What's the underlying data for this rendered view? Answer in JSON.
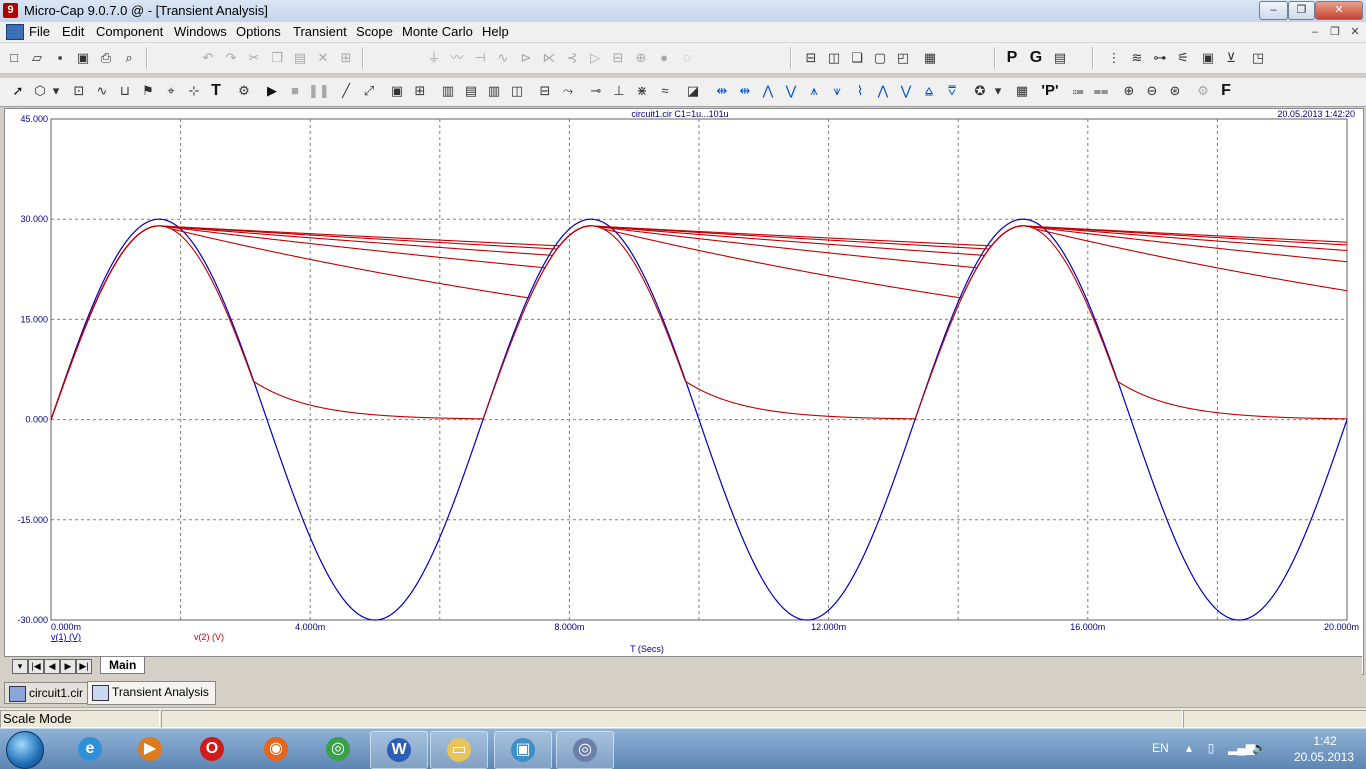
{
  "window": {
    "title": "Micro-Cap 9.0.7.0 @ - [Transient Analysis]",
    "app_icon_letter": "9",
    "controls": {
      "minimize": "–",
      "maximize": "❐",
      "close": "✕"
    },
    "mdi_controls": {
      "minimize": "–",
      "restore": "❐",
      "close": "✕"
    }
  },
  "menu": [
    "File",
    "Edit",
    "Component",
    "Windows",
    "Options",
    "Transient",
    "Scope",
    "Monte Carlo",
    "Help"
  ],
  "toolbar1": {
    "letter_buttons": [
      "P",
      "G"
    ]
  },
  "toolbar2": {
    "letter_buttons": [
      "'P'",
      "F"
    ],
    "text_tool": "T"
  },
  "plot": {
    "header_center": "circuit1.cir C1=1u...101u",
    "header_right": "20.05.2013 1:42:20",
    "xlabel": "T (Secs)",
    "legend": [
      {
        "label": "v(1) (V)",
        "color": "#0000c0"
      },
      {
        "label": "v(2) (V)",
        "color": "#c00000"
      }
    ],
    "colors": {
      "grid": "#808080",
      "axis_text": "#000080"
    }
  },
  "chart_data": {
    "type": "line",
    "x_unit_label": "T (Secs)",
    "xlim": [
      0,
      0.02
    ],
    "ylim": [
      -30,
      45
    ],
    "x_ticks": [
      "0.000m",
      "4.000m",
      "8.000m",
      "12.000m",
      "16.000m",
      "20.000m"
    ],
    "y_ticks": [
      "45.000",
      "30.000",
      "15.000",
      "0.000",
      "-15.000",
      "-30.000"
    ],
    "grid": true,
    "series": [
      {
        "name": "v(1) (V)",
        "color": "#0000c0",
        "waveform": "sine",
        "amplitude": 30,
        "frequency_hz": 150,
        "x": [
          0,
          0.00167,
          0.00333,
          0.005,
          0.00667,
          0.00833,
          0.01,
          0.01167,
          0.01333,
          0.015,
          0.01667,
          0.01833,
          0.02
        ],
        "y": [
          0,
          30,
          0,
          -30,
          0,
          30,
          0,
          -30,
          0,
          30,
          0,
          -30,
          0
        ]
      },
      {
        "name": "v(2) (V)",
        "color": "#c00000",
        "waveform": "rectified-rc",
        "peak": 29,
        "decay_end_values": [
          0,
          17.5,
          22.5,
          24.5,
          25.5,
          26
        ]
      }
    ]
  },
  "tabs": {
    "main_tab": "Main",
    "nav": [
      "▾",
      "|◀",
      "◀",
      "▶",
      "▶|"
    ]
  },
  "doc_tabs": [
    "circuit1.cir",
    "Transient Analysis"
  ],
  "status": {
    "mode": "Scale Mode"
  },
  "taskbar": {
    "lang": "EN",
    "time": "1:42",
    "date": "20.05.2013",
    "apps": [
      {
        "name": "internet-explorer",
        "glyph": "e",
        "color": "#2f8fd8"
      },
      {
        "name": "media-player",
        "glyph": "▶",
        "color": "#e07a1a"
      },
      {
        "name": "opera",
        "glyph": "O",
        "color": "#d11a1a"
      },
      {
        "name": "firefox",
        "glyph": "◉",
        "color": "#e5661c"
      },
      {
        "name": "chrome",
        "glyph": "◎",
        "color": "#3aa04a"
      },
      {
        "name": "word",
        "glyph": "W",
        "color": "#2b5eb8"
      },
      {
        "name": "explorer",
        "glyph": "▭",
        "color": "#e8c45a"
      },
      {
        "name": "photo-viewer",
        "glyph": "▣",
        "color": "#3c8fc9"
      },
      {
        "name": "micro-cap",
        "glyph": "◎",
        "color": "#6c7fa8"
      }
    ]
  }
}
